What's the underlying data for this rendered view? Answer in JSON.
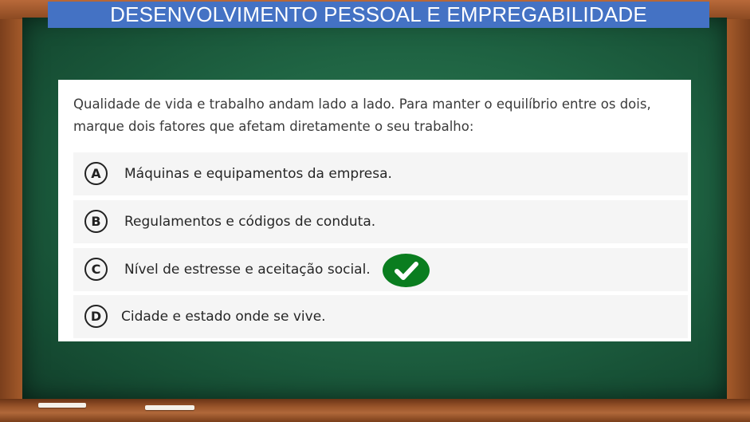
{
  "header": {
    "title": "DESENVOLVIMENTO PESSOAL E EMPREGABILIDADE"
  },
  "question": {
    "line1": "Qualidade de vida e trabalho andam lado a lado. Para manter o equilíbrio entre os dois,",
    "line2": "marque dois fatores que afetam diretamente o seu trabalho:"
  },
  "options": [
    {
      "letter": "A",
      "text": "Máquinas e equipamentos da empresa."
    },
    {
      "letter": "B",
      "text": "Regulamentos e códigos de conduta."
    },
    {
      "letter": "C",
      "text": "Nível de estresse e aceitação social.",
      "correct": true
    },
    {
      "letter": "D",
      "text": "Cidade e estado onde se vive."
    }
  ],
  "colors": {
    "title_bg": "#4472c4",
    "board": "#1f6443",
    "check": "#0a7d1f"
  },
  "icons": {
    "correct_mark": "checkmark-badge-icon"
  }
}
